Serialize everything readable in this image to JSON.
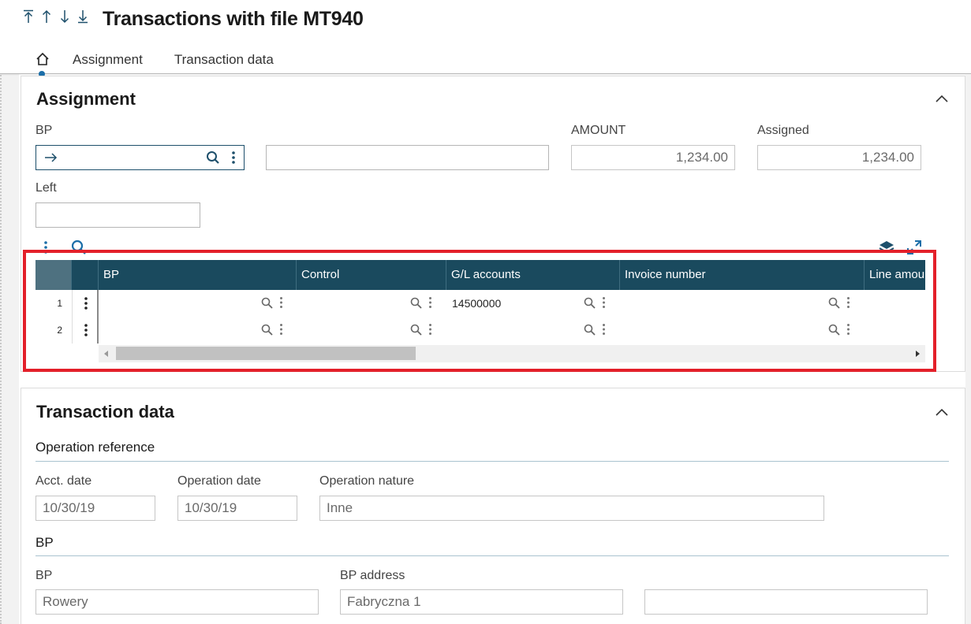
{
  "header": {
    "title": "Transactions with file MT940",
    "nav_icons": [
      "first-record-icon",
      "previous-record-icon",
      "next-record-icon",
      "last-record-icon"
    ],
    "tabs": [
      {
        "label": "Assignment"
      },
      {
        "label": "Transaction data"
      }
    ],
    "accent": "#1b6ea8"
  },
  "assignment": {
    "title": "Assignment",
    "bp_label": "BP",
    "bp_value": "",
    "bp_desc_value": "",
    "amount_label": "AMOUNT",
    "amount_value": "1,234.00",
    "assigned_label": "Assigned",
    "assigned_value": "1,234.00",
    "left_label": "Left",
    "left_value": "",
    "grid": {
      "columns": [
        "BP",
        "Control",
        "G/L accounts",
        "Invoice number",
        "Line amou"
      ],
      "rows": [
        {
          "num": "1",
          "bp": "",
          "control": "",
          "gl": "14500000",
          "invoice": ""
        },
        {
          "num": "2",
          "bp": "",
          "control": "",
          "gl": "",
          "invoice": ""
        }
      ],
      "header_color": "#1a4a5e",
      "highlight_color": "#e3202a"
    }
  },
  "transaction": {
    "title": "Transaction data",
    "op_ref_heading": "Operation reference",
    "acct_date_label": "Acct. date",
    "acct_date_value": "10/30/19",
    "op_date_label": "Operation date",
    "op_date_value": "10/30/19",
    "op_nature_label": "Operation nature",
    "op_nature_value": "Inne",
    "bp_heading": "BP",
    "bp_label": "BP",
    "bp_value": "Rowery",
    "bp_address_label": "BP address",
    "bp_address_value": "Fabryczna 1",
    "bp_address_extra": ""
  }
}
